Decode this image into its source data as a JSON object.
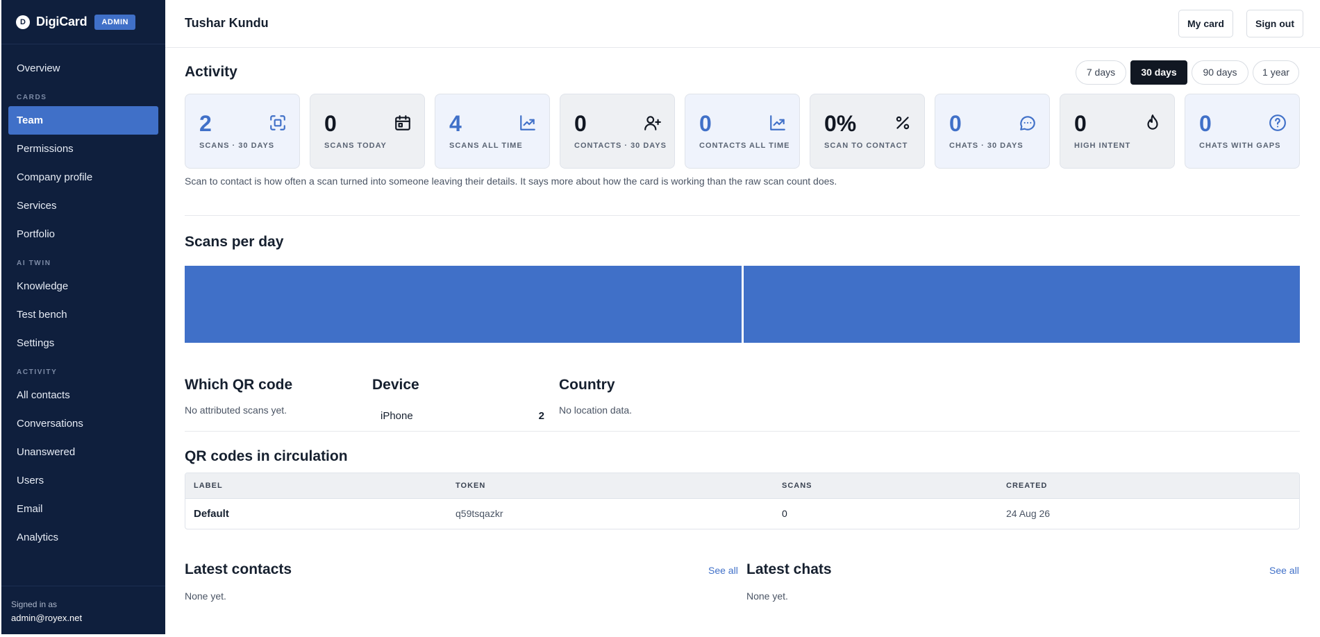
{
  "sidebar": {
    "brand": "DigiCard",
    "brand_initial": "D",
    "badge": "ADMIN",
    "items_top": [
      {
        "label": "Overview"
      }
    ],
    "section_cards": "CARDS",
    "items_cards": [
      {
        "label": "Team",
        "active": true
      },
      {
        "label": "Permissions"
      },
      {
        "label": "Company profile"
      },
      {
        "label": "Services"
      },
      {
        "label": "Portfolio"
      }
    ],
    "section_ai": "AI TWIN",
    "items_ai": [
      {
        "label": "Knowledge"
      },
      {
        "label": "Test bench"
      },
      {
        "label": "Settings"
      }
    ],
    "section_activity": "ACTIVITY",
    "items_activity": [
      {
        "label": "All contacts"
      },
      {
        "label": "Conversations"
      },
      {
        "label": "Unanswered"
      },
      {
        "label": "Users"
      },
      {
        "label": "Email"
      },
      {
        "label": "Analytics"
      }
    ],
    "signed_in_label": "Signed in as",
    "signed_in_email": "admin@royex.net"
  },
  "header": {
    "title": "Tushar Kundu",
    "my_card": "My card",
    "sign_out": "Sign out"
  },
  "activity": {
    "title": "Activity",
    "ranges": [
      "7 days",
      "30 days",
      "90 days",
      "1 year"
    ],
    "selected_range": "30 days",
    "stats": [
      {
        "value": "2",
        "label": "SCANS · 30 DAYS",
        "icon": "scan-icon",
        "tone": "blue"
      },
      {
        "value": "0",
        "label": "SCANS TODAY",
        "icon": "calendar-icon",
        "tone": "gray"
      },
      {
        "value": "4",
        "label": "SCANS ALL TIME",
        "icon": "trend-icon",
        "tone": "blue"
      },
      {
        "value": "0",
        "label": "CONTACTS · 30 DAYS",
        "icon": "user-plus-icon",
        "tone": "gray"
      },
      {
        "value": "0",
        "label": "CONTACTS ALL TIME",
        "icon": "trend-icon",
        "tone": "blue"
      },
      {
        "value": "0%",
        "label": "SCAN TO CONTACT",
        "icon": "percent-icon",
        "tone": "gray"
      },
      {
        "value": "0",
        "label": "CHATS · 30 DAYS",
        "icon": "chat-icon",
        "tone": "blue"
      },
      {
        "value": "0",
        "label": "HIGH INTENT",
        "icon": "flame-icon",
        "tone": "gray"
      },
      {
        "value": "0",
        "label": "CHATS WITH GAPS",
        "icon": "question-icon",
        "tone": "blue"
      }
    ],
    "note": "Scan to contact is how often a scan turned into someone leaving their details. It says more about how the card is working than the raw scan count does."
  },
  "scans_per_day": {
    "title": "Scans per day"
  },
  "chart_data": {
    "type": "bar",
    "categories": [
      "",
      ""
    ],
    "values": [
      1,
      1
    ],
    "title": "Scans per day",
    "xlabel": "",
    "ylabel": "",
    "color": "#4070c8"
  },
  "breakdowns": {
    "qr_title": "Which QR code",
    "qr_empty": "No attributed scans yet.",
    "device_title": "Device",
    "devices": [
      {
        "name": "iPhone",
        "count": "2"
      }
    ],
    "country_title": "Country",
    "country_empty": "No location data."
  },
  "qr_codes": {
    "title": "QR codes in circulation",
    "columns": [
      "LABEL",
      "TOKEN",
      "SCANS",
      "CREATED"
    ],
    "rows": [
      {
        "label": "Default",
        "token": "q59tsqazkr",
        "scans": "0",
        "created": "24 Aug 26"
      }
    ]
  },
  "latest_contacts": {
    "title": "Latest contacts",
    "see_all": "See all",
    "empty": "None yet."
  },
  "latest_chats": {
    "title": "Latest chats",
    "see_all": "See all",
    "empty": "None yet."
  },
  "colors": {
    "sidebar": "#0f1f3d",
    "accent": "#4070c8",
    "dark": "#111722"
  }
}
